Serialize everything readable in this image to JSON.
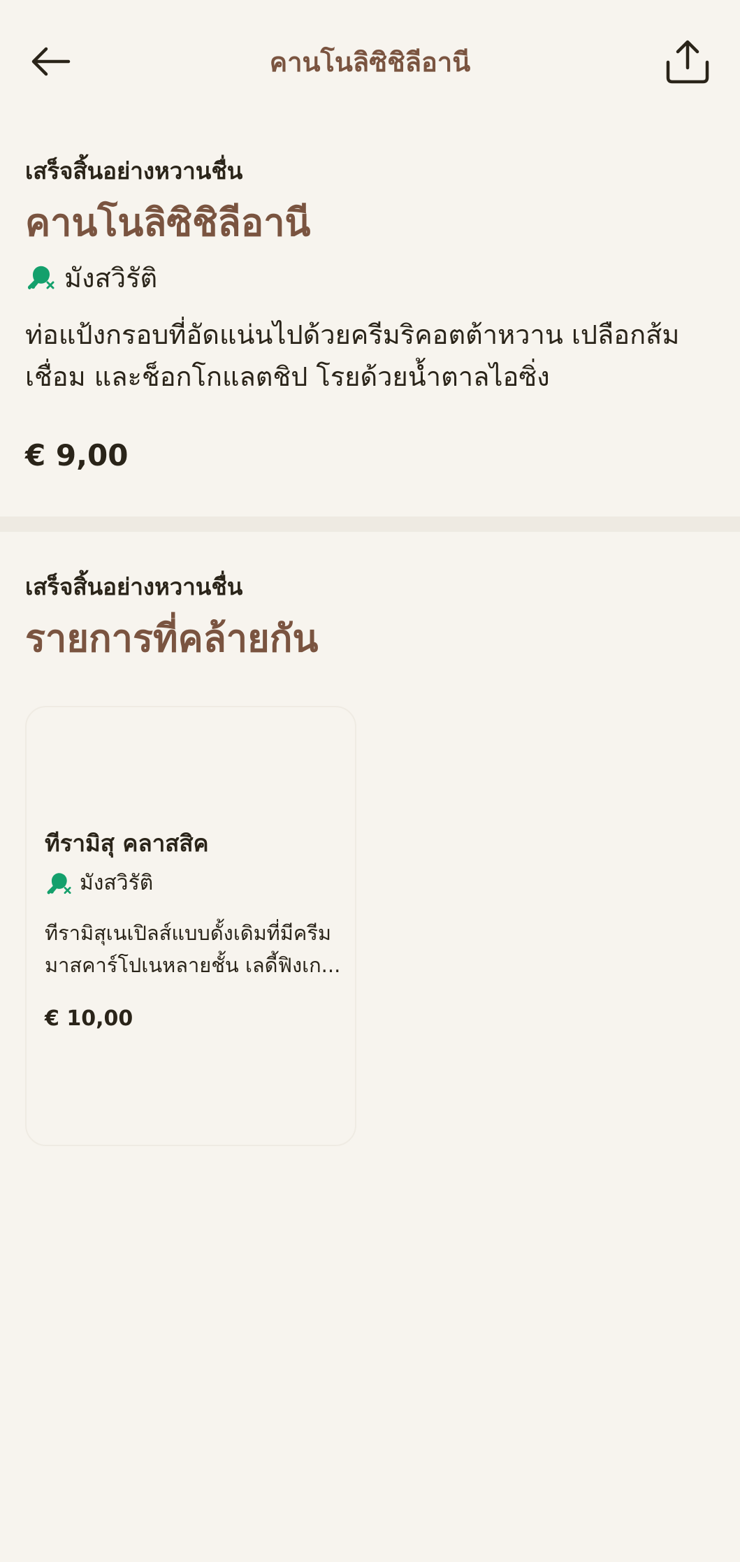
{
  "header": {
    "title": "คานโนลิซิชิลีอานี",
    "back_icon": "arrow-left-icon",
    "share_icon": "share-upload-icon"
  },
  "product": {
    "category": "เสร็จสิ้นอย่างหวานชื่น",
    "name": "คานโนลิซิชิลีอานี",
    "diet_icon": "vegetarian-no-meat-icon",
    "diet_label": "มังสวิรัติ",
    "description": "ท่อแป้งกรอบที่อัดแน่นไปด้วยครีมริคอตต้าหวาน เปลือกส้มเชื่อม และช็อกโกแลตชิป โรยด้วยน้ำตาลไอซิ่ง",
    "price": "€ 9,00"
  },
  "similar": {
    "category": "เสร็จสิ้นอย่างหวานชื่น",
    "title": "รายการที่คล้ายกัน",
    "items": [
      {
        "name": "ทีรามิสุ คลาสสิค",
        "diet_label": "มังสวิรัติ",
        "description": "ทีรามิสุเนเปิลส์แบบดั้งเดิมที่มีครีมมาสคาร์โปเนหลายชั้น เลดี้ฟิงเก...",
        "price": "€ 10,00"
      }
    ]
  },
  "colors": {
    "background": "#f7f4ee",
    "accent_brown": "#7a5440",
    "diet_green": "#14a06c",
    "text": "#2a2419"
  }
}
